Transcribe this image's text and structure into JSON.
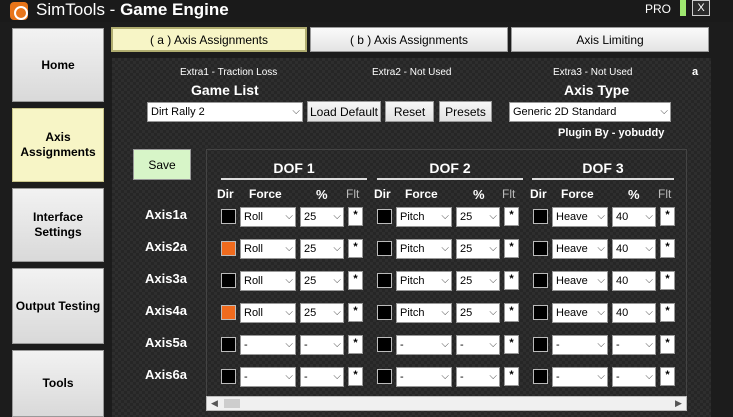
{
  "window": {
    "title_prefix": "SimTools - ",
    "title_bold": "Game Engine",
    "edition": "PRO",
    "close_label": "X"
  },
  "sidebar": {
    "items": [
      {
        "label": "Home"
      },
      {
        "label": "Axis Assignments"
      },
      {
        "label": "Interface Settings"
      },
      {
        "label": "Output Testing"
      },
      {
        "label": "Tools"
      }
    ]
  },
  "tabs": [
    {
      "label": "( a ) Axis Assignments"
    },
    {
      "label": "( b ) Axis Assignments"
    },
    {
      "label": "Axis Limiting"
    }
  ],
  "extras": {
    "extra1": "Extra1 - Traction Loss",
    "extra2": "Extra2 - Not Used",
    "extra3": "Extra3 - Not Used",
    "corner": "a"
  },
  "game": {
    "heading": "Game List",
    "selected": "Dirt Rally 2",
    "load_default": "Load Default",
    "reset": "Reset",
    "presets": "Presets"
  },
  "axis_type": {
    "heading": "Axis Type",
    "selected": "Generic 2D Standard",
    "plugin_by": "Plugin By - yobuddy"
  },
  "save_label": "Save",
  "dof_headers": [
    "DOF 1",
    "DOF 2",
    "DOF 3"
  ],
  "columns": {
    "dir": "Dir",
    "force": "Force",
    "pct": "%",
    "flt": "Flt"
  },
  "flt_label": "*",
  "rows": [
    {
      "axis": "Axis1a",
      "dof": [
        {
          "dir": false,
          "force": "Roll",
          "pct": "25"
        },
        {
          "dir": false,
          "force": "Pitch",
          "pct": "25"
        },
        {
          "dir": false,
          "force": "Heave",
          "pct": "40"
        }
      ]
    },
    {
      "axis": "Axis2a",
      "dof": [
        {
          "dir": true,
          "force": "Roll",
          "pct": "25"
        },
        {
          "dir": false,
          "force": "Pitch",
          "pct": "25"
        },
        {
          "dir": false,
          "force": "Heave",
          "pct": "40"
        }
      ]
    },
    {
      "axis": "Axis3a",
      "dof": [
        {
          "dir": false,
          "force": "Roll",
          "pct": "25"
        },
        {
          "dir": false,
          "force": "Pitch",
          "pct": "25"
        },
        {
          "dir": false,
          "force": "Heave",
          "pct": "40"
        }
      ]
    },
    {
      "axis": "Axis4a",
      "dof": [
        {
          "dir": true,
          "force": "Roll",
          "pct": "25"
        },
        {
          "dir": false,
          "force": "Pitch",
          "pct": "25"
        },
        {
          "dir": false,
          "force": "Heave",
          "pct": "40"
        }
      ]
    },
    {
      "axis": "Axis5a",
      "dof": [
        {
          "dir": false,
          "force": "-",
          "pct": "-"
        },
        {
          "dir": false,
          "force": "-",
          "pct": "-"
        },
        {
          "dir": false,
          "force": "-",
          "pct": "-"
        }
      ]
    },
    {
      "axis": "Axis6a",
      "dof": [
        {
          "dir": false,
          "force": "-",
          "pct": "-"
        },
        {
          "dir": false,
          "force": "-",
          "pct": "-"
        },
        {
          "dir": false,
          "force": "-",
          "pct": "-"
        }
      ]
    }
  ],
  "colors": {
    "dir_on": "#f06b1e",
    "active_tab": "#f7f5c6",
    "save": "#d7f5c8"
  }
}
